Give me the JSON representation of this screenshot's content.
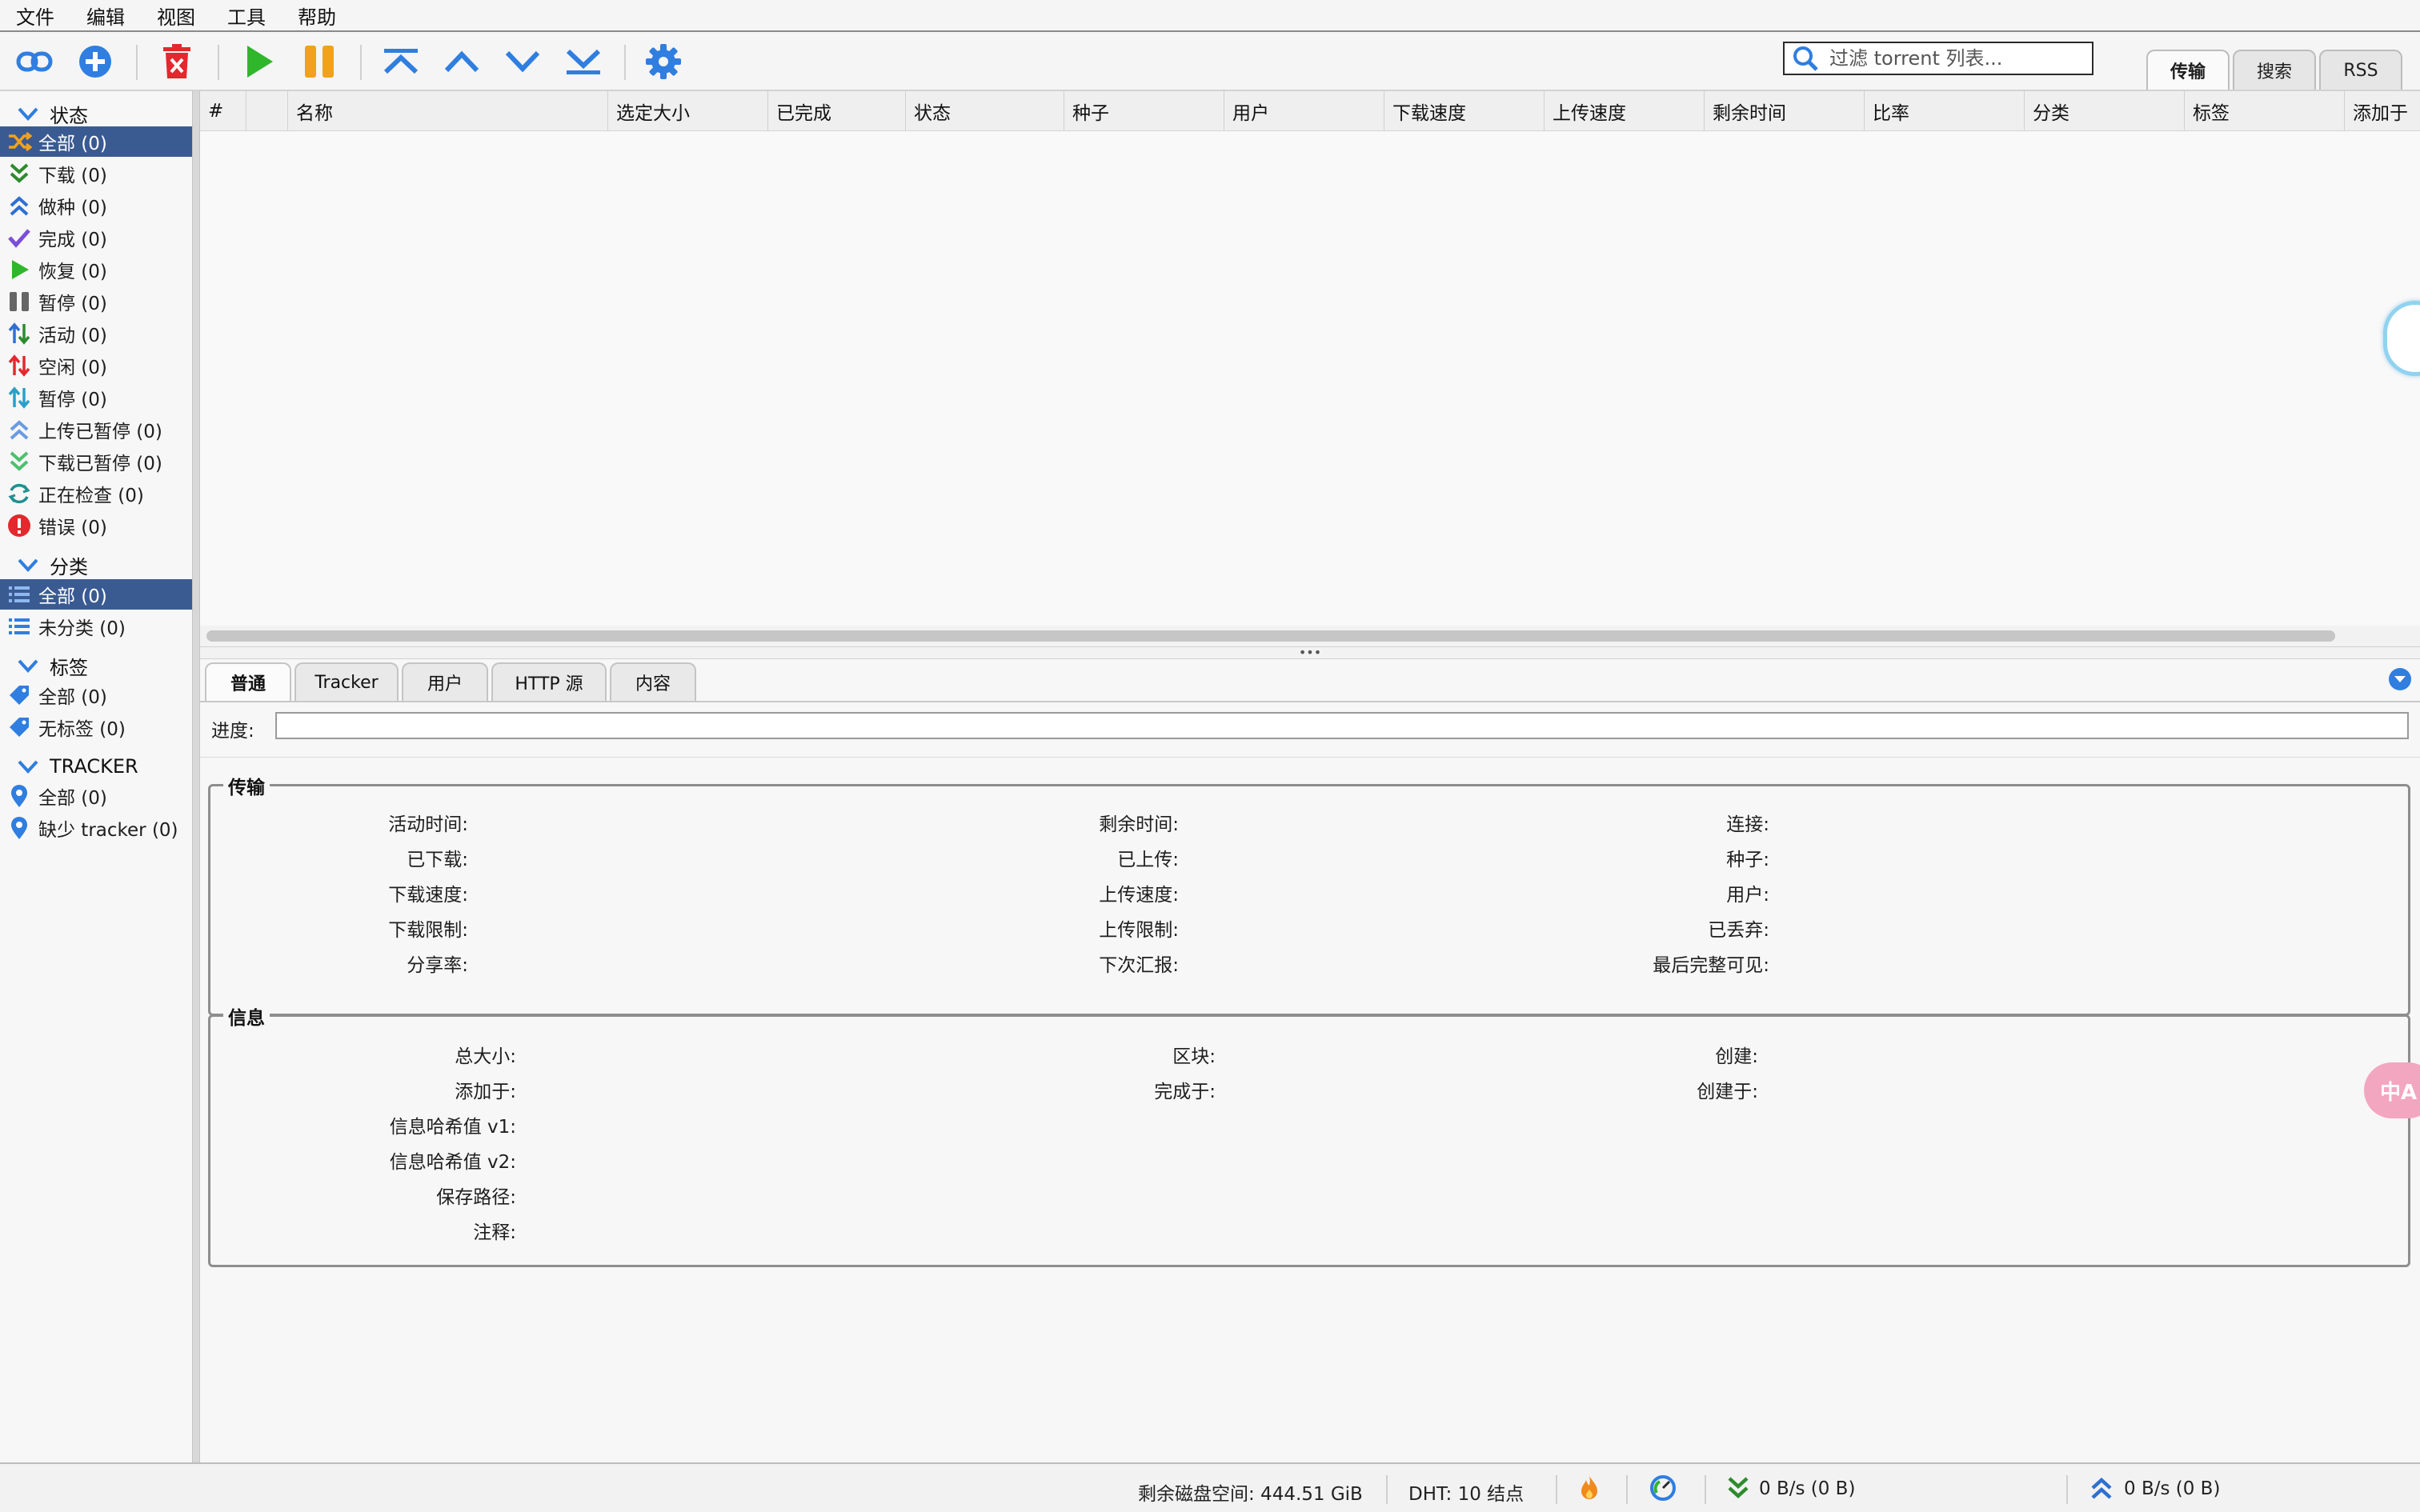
{
  "menu": [
    "文件",
    "编辑",
    "视图",
    "工具",
    "帮助"
  ],
  "toolbar": {
    "buttons": [
      "add-link",
      "add-torrent",
      "delete",
      "resume",
      "pause",
      "move-top",
      "move-up",
      "move-down",
      "move-bottom",
      "options"
    ],
    "filter_placeholder": "过滤 torrent 列表...",
    "tabs": [
      "传输",
      "搜索",
      "RSS"
    ],
    "active_tab": "传输"
  },
  "sidebar": {
    "status_header": "状态",
    "status_items": [
      {
        "label": "全部 (0)",
        "icon": "all-icon"
      },
      {
        "label": "下载 (0)",
        "icon": "downloading-icon"
      },
      {
        "label": "做种 (0)",
        "icon": "seeding-icon"
      },
      {
        "label": "完成 (0)",
        "icon": "completed-icon"
      },
      {
        "label": "恢复 (0)",
        "icon": "resumed-icon"
      },
      {
        "label": "暂停 (0)",
        "icon": "paused-icon"
      },
      {
        "label": "活动 (0)",
        "icon": "active-icon"
      },
      {
        "label": "空闲 (0)",
        "icon": "inactive-icon"
      },
      {
        "label": "暂停 (0)",
        "icon": "stalled-icon"
      },
      {
        "label": "上传已暂停 (0)",
        "icon": "stalled-upload-icon"
      },
      {
        "label": "下载已暂停 (0)",
        "icon": "stalled-download-icon"
      },
      {
        "label": "正在检查 (0)",
        "icon": "checking-icon"
      },
      {
        "label": "错误 (0)",
        "icon": "error-icon"
      }
    ],
    "category_header": "分类",
    "category_items": [
      {
        "label": "全部 (0)",
        "icon": "list-icon"
      },
      {
        "label": "未分类 (0)",
        "icon": "list-icon"
      }
    ],
    "tag_header": "标签",
    "tag_items": [
      {
        "label": "全部 (0)",
        "icon": "tag-icon"
      },
      {
        "label": "无标签 (0)",
        "icon": "tag-icon"
      }
    ],
    "tracker_header": "TRACKER",
    "tracker_items": [
      {
        "label": "全部 (0)",
        "icon": "location-pin-icon"
      },
      {
        "label": "缺少 tracker (0)",
        "icon": "location-pin-icon"
      }
    ]
  },
  "transfer_list": {
    "columns": [
      "#",
      "",
      "名称",
      "选定大小",
      "已完成",
      "状态",
      "种子",
      "用户",
      "下载速度",
      "上传速度",
      "剩余时间",
      "比率",
      "分类",
      "标签",
      "添加于"
    ],
    "rows": []
  },
  "properties": {
    "tabs": [
      "普通",
      "Tracker",
      "用户",
      "HTTP 源",
      "内容"
    ],
    "active_tab": "普通",
    "progress_label": "进度:",
    "progress_value": 0,
    "transfer_title": "传输",
    "transfer_fields": [
      [
        "活动时间:",
        "剩余时间:",
        "连接:"
      ],
      [
        "已下载:",
        "已上传:",
        "种子:"
      ],
      [
        "下载速度:",
        "上传速度:",
        "用户:"
      ],
      [
        "下载限制:",
        "上传限制:",
        "已丢弃:"
      ],
      [
        "分享率:",
        "下次汇报:",
        "最后完整可见:"
      ]
    ],
    "info_title": "信息",
    "info_fields_grid": [
      [
        "总大小:",
        "区块:",
        "创建:"
      ],
      [
        "添加于:",
        "完成于:",
        "创建于:"
      ]
    ],
    "info_fields_single": [
      "信息哈希值 v1:",
      "信息哈希值 v2:",
      "保存路径:",
      "注释:"
    ]
  },
  "statusbar": {
    "free_space": "剩余磁盘空间: 444.51 GiB",
    "dht": "DHT: 10 结点",
    "download": "0 B/s (0 B)",
    "upload": "0 B/s (0 B)"
  },
  "colors": {
    "accent": "#2f7ee0",
    "selection": "#3a5a92",
    "resume_green": "#2fb62a",
    "pause_orange": "#f0a21d",
    "delete_red": "#e4282e",
    "download_green": "#2e8b2e"
  },
  "widgets": {
    "translate_label": "中A"
  }
}
